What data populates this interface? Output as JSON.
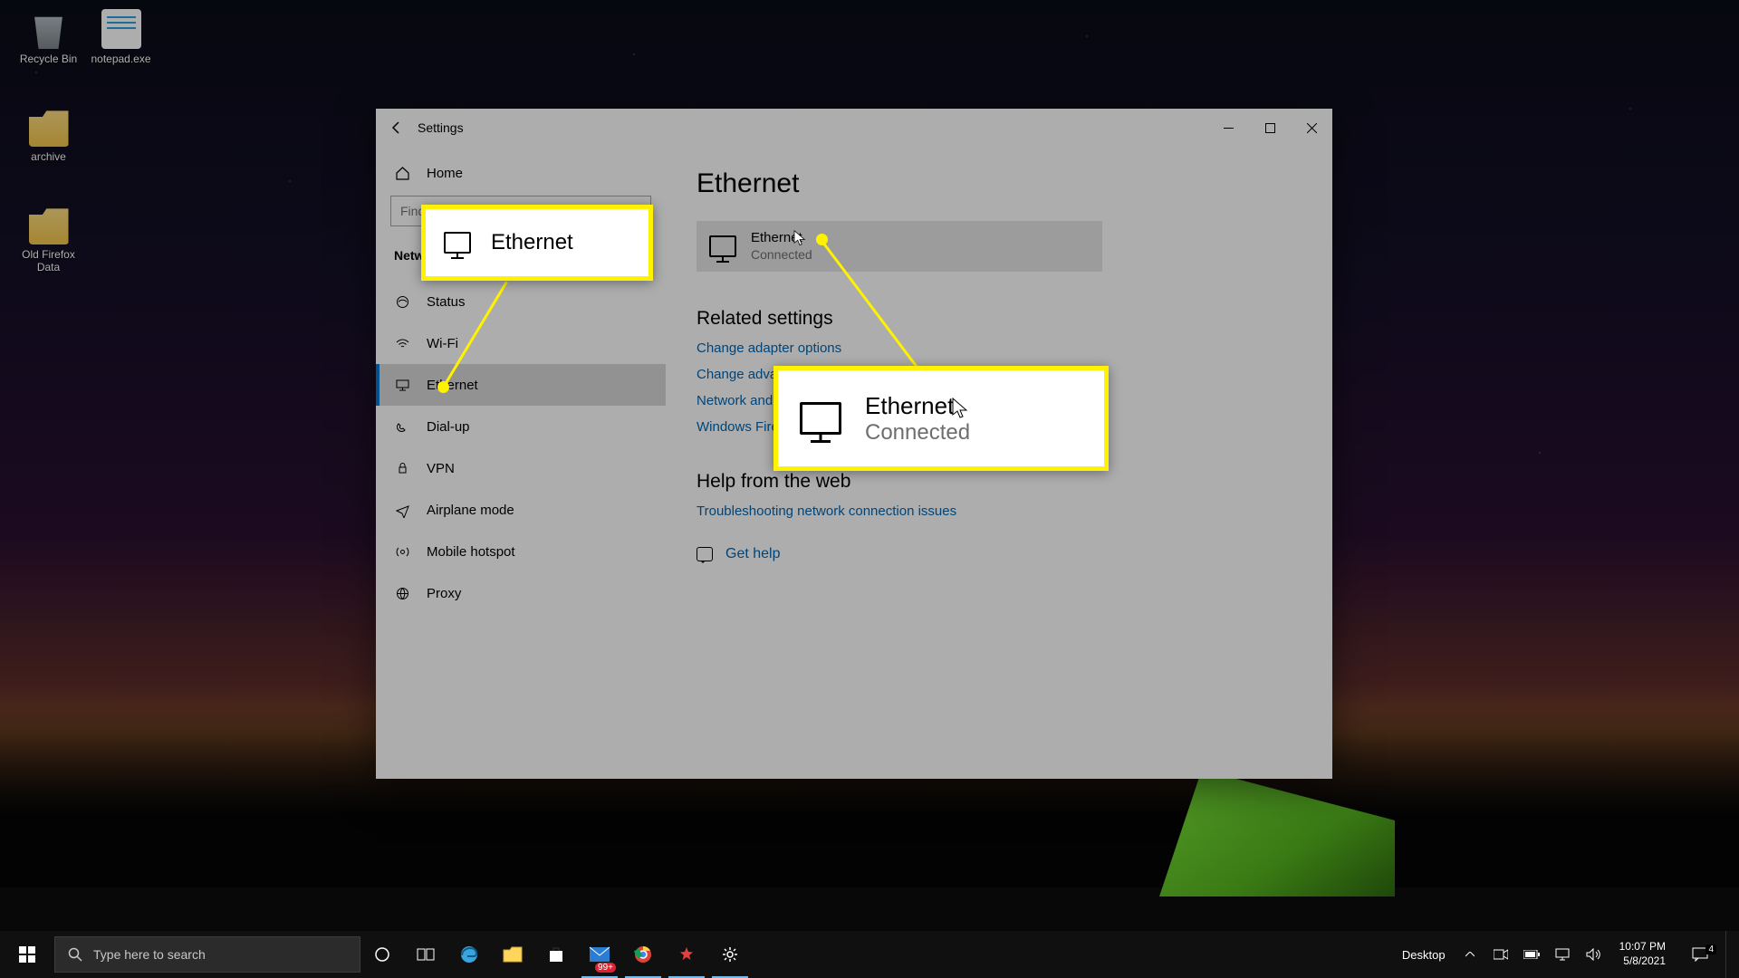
{
  "desktop": {
    "icons": [
      {
        "label": "Recycle Bin"
      },
      {
        "label": "notepad.exe"
      },
      {
        "label": "archive"
      },
      {
        "label": "Old Firefox Data"
      }
    ]
  },
  "window": {
    "title": "Settings",
    "sidebar": {
      "home": "Home",
      "search_placeholder": "Find a setting",
      "category": "Network & Internet",
      "items": [
        {
          "label": "Status"
        },
        {
          "label": "Wi-Fi"
        },
        {
          "label": "Ethernet"
        },
        {
          "label": "Dial-up"
        },
        {
          "label": "VPN"
        },
        {
          "label": "Airplane mode"
        },
        {
          "label": "Mobile hotspot"
        },
        {
          "label": "Proxy"
        }
      ]
    },
    "content": {
      "title": "Ethernet",
      "card": {
        "name": "Ethernet",
        "status": "Connected"
      },
      "related_heading": "Related settings",
      "related_links": [
        "Change adapter options",
        "Change advanced sharing options",
        "Network and Sharing Center",
        "Windows Firewall"
      ],
      "help_heading": "Help from the web",
      "help_links": [
        "Troubleshooting network connection issues"
      ],
      "gethelp": "Get help"
    }
  },
  "callouts": {
    "c1_label": "Ethernet",
    "c2_name": "Ethernet",
    "c2_status": "Connected"
  },
  "taskbar": {
    "search_placeholder": "Type here to search",
    "tray": {
      "desktop_label": "Desktop",
      "badge": "99+",
      "notif": "4"
    },
    "clock": {
      "time": "10:07 PM",
      "date": "5/8/2021"
    }
  }
}
